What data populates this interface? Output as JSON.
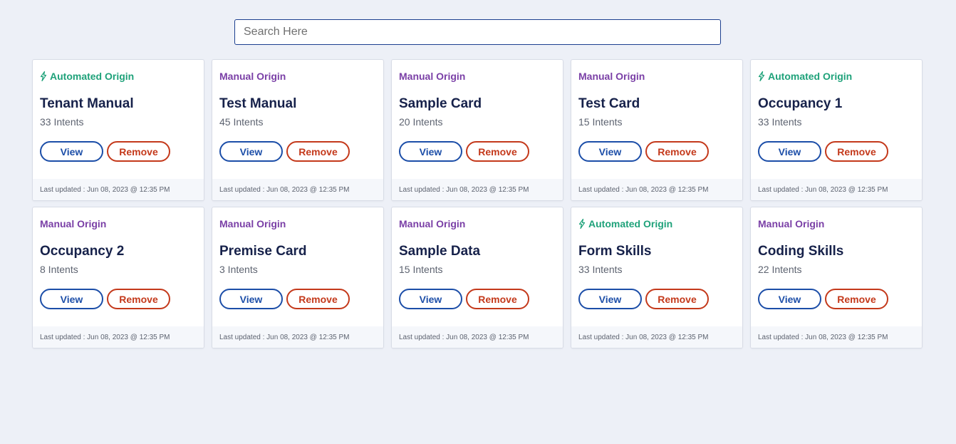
{
  "search": {
    "placeholder": "Search Here",
    "value": ""
  },
  "colors": {
    "background": "#edf0f7",
    "manual_origin": "#7a3fa6",
    "automated_origin": "#1fa27a",
    "view_button": "#1c4ea8",
    "remove_button": "#c4391b",
    "title": "#16214a"
  },
  "labels": {
    "view": "View",
    "remove": "Remove"
  },
  "cards": [
    {
      "origin": "Automated Origin",
      "origin_type": "automated",
      "origin_icon": "bolt-icon",
      "title": "Tenant Manual",
      "intents": "33 Intents",
      "updated": "Last updated : Jun 08, 2023 @ 12:35 PM"
    },
    {
      "origin": "Manual Origin",
      "origin_type": "manual",
      "title": "Test Manual",
      "intents": "45 Intents",
      "updated": "Last updated : Jun 08, 2023 @ 12:35 PM"
    },
    {
      "origin": "Manual Origin",
      "origin_type": "manual",
      "title": "Sample Card",
      "intents": "20 Intents",
      "updated": "Last updated : Jun 08, 2023 @ 12:35 PM"
    },
    {
      "origin": "Manual Origin",
      "origin_type": "manual",
      "title": "Test Card",
      "intents": "15 Intents",
      "updated": "Last updated : Jun 08, 2023 @ 12:35 PM"
    },
    {
      "origin": "Automated Origin",
      "origin_type": "automated",
      "origin_icon": "bolt-icon",
      "title": "Occupancy 1",
      "intents": "33 Intents",
      "updated": "Last updated : Jun 08, 2023 @ 12:35 PM"
    },
    {
      "origin": "Manual Origin",
      "origin_type": "manual",
      "title": "Occupancy 2",
      "intents": "8 Intents",
      "updated": "Last updated : Jun 08, 2023 @ 12:35 PM"
    },
    {
      "origin": "Manual Origin",
      "origin_type": "manual",
      "title": "Premise Card",
      "intents": "3 Intents",
      "updated": "Last updated : Jun 08, 2023 @ 12:35 PM"
    },
    {
      "origin": "Manual Origin",
      "origin_type": "manual",
      "title": "Sample Data",
      "intents": "15 Intents",
      "updated": "Last updated : Jun 08, 2023 @ 12:35 PM"
    },
    {
      "origin": "Automated Origin",
      "origin_type": "automated",
      "origin_icon": "bolt-icon",
      "title": "Form Skills",
      "intents": "33 Intents",
      "updated": "Last updated : Jun 08, 2023 @ 12:35 PM"
    },
    {
      "origin": "Manual Origin",
      "origin_type": "manual",
      "title": "Coding Skills",
      "intents": "22 Intents",
      "updated": "Last updated : Jun 08, 2023 @ 12:35 PM"
    }
  ]
}
